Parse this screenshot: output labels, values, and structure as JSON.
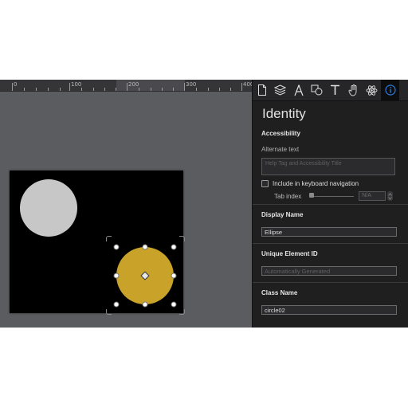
{
  "ruler": {
    "labels": [
      "0",
      "100",
      "200",
      "300",
      "400"
    ]
  },
  "toolbar": {
    "tabs": [
      {
        "icon": "document-icon"
      },
      {
        "icon": "layers-icon"
      },
      {
        "icon": "pen-icon"
      },
      {
        "icon": "shapes-icon"
      },
      {
        "icon": "text-icon"
      },
      {
        "icon": "hand-icon"
      },
      {
        "icon": "atom-icon"
      },
      {
        "icon": "info-icon",
        "active": true
      }
    ]
  },
  "inspector": {
    "title": "Identity",
    "accessibility": {
      "heading": "Accessibility",
      "alt_label": "Alternate text",
      "alt_placeholder": "Help Tag and Accessibility Title",
      "keyboard_nav_label": "Include in keyboard navigation",
      "keyboard_nav_checked": false,
      "tab_index_label": "Tab index",
      "tab_index_value": "N/A"
    },
    "display_name": {
      "heading": "Display Name",
      "value": "Ellipse"
    },
    "unique_id": {
      "heading": "Unique Element ID",
      "placeholder": "Automatically Generated"
    },
    "class_name": {
      "heading": "Class Name",
      "value": "circle02"
    }
  },
  "colors": {
    "circle_gray": "#c7c7c7",
    "circle_gold": "#c9a22a",
    "artboard": "#000000",
    "accent_blue": "#2a7de1"
  }
}
